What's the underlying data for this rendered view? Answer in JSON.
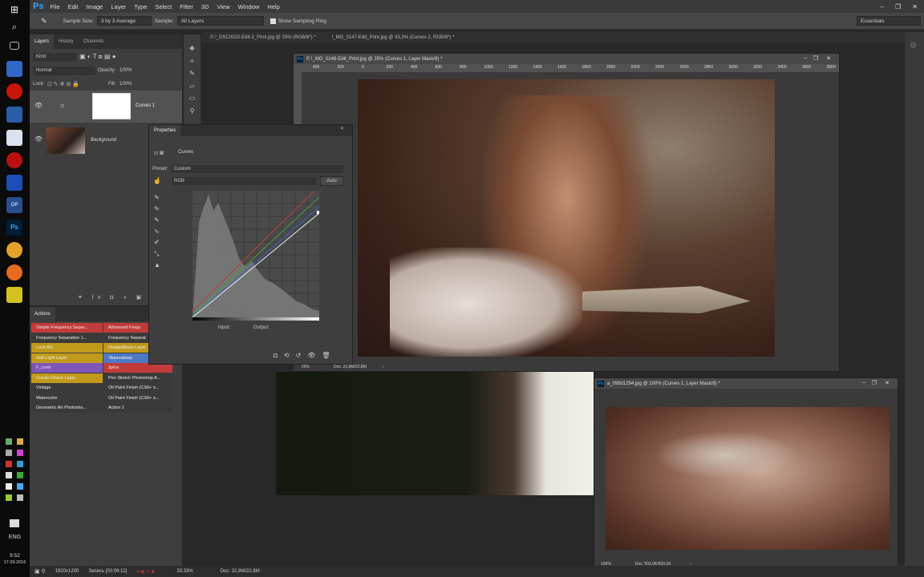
{
  "taskbar": {
    "lang": "ENG",
    "time": "9:52",
    "date": "17.09.2016"
  },
  "app": {
    "logo": "Ps"
  },
  "menu": [
    "File",
    "Edit",
    "Image",
    "Layer",
    "Type",
    "Select",
    "Filter",
    "3D",
    "View",
    "Window",
    "Help"
  ],
  "options": {
    "sample_size_label": "Sample Size:",
    "sample_size": "3 by 3 Average",
    "sample_label": "Sample:",
    "sample": "All Layers",
    "show_ring": "Show Sampling Ring",
    "workspace": "Essentials"
  },
  "layers_panel": {
    "tabs": [
      "Layers",
      "History",
      "Channels"
    ],
    "kind": "Kind",
    "blend": "Normal",
    "opacity_label": "Opacity:",
    "opacity": "100%",
    "lock_label": "Lock:",
    "fill_label": "Fill:",
    "fill": "100%",
    "layers": [
      {
        "name": "Curves 1"
      },
      {
        "name": "Background"
      }
    ]
  },
  "actions_panel": {
    "title": "Actions",
    "col1": [
      {
        "label": "Simple Frequency Separ...",
        "color": "#c23b3b"
      },
      {
        "label": "Frequency Separation 1...",
        "color": "#3a3a3a"
      },
      {
        "label": "Lock BG",
        "color": "#c29a1b"
      },
      {
        "label": "Soft Light Layer",
        "color": "#c29a1b"
      },
      {
        "label": "F_contr",
        "color": "#7d56b8"
      },
      {
        "label": "Create Check-Layer",
        "color": "#c29a1b"
      },
      {
        "label": "Vintage",
        "color": "#3a3a3a"
      },
      {
        "label": "Watercolor",
        "color": "#3a3a3a"
      },
      {
        "label": "Geometric Art Photosho...",
        "color": "#3a3a3a"
      }
    ],
    "col2": [
      {
        "label": "Advanced Frequ",
        "color": "#c23b3b"
      },
      {
        "label": "Frequency Separat",
        "color": "#3a3a3a"
      },
      {
        "label": "Dodge&Burn Layer",
        "color": "#c29a1b"
      },
      {
        "label": "Эквалайзер",
        "color": "#4d78c4"
      },
      {
        "label": "3plos",
        "color": "#c23b3b"
      },
      {
        "label": "Pen Sketch Photoshop A...",
        "color": "#3a3a3a"
      },
      {
        "label": "Oil Paint Finish (CS6+ o...",
        "color": "#3a3a3a"
      },
      {
        "label": "Oil Paint Finish (CS6+ o...",
        "color": "#3a3a3a"
      },
      {
        "label": "Action 1",
        "color": "#3a3a3a"
      }
    ]
  },
  "doc_tabs": [
    "© !_DSC0020-Edit-2_Print.jpg @ 25% (RGB/8*) *",
    "!_MG_0147-Edit_Print.jpg @ 33,3% (Curves 2, RGB/8*) *"
  ],
  "doc1": {
    "title": "© !_MG_0148-Edit_Print.jpg @ 25% (Curves 1, Layer Mask/8) *",
    "ruler": [
      "400",
      "200",
      "0",
      "200",
      "400",
      "600",
      "800",
      "1000",
      "1200",
      "1400",
      "1600",
      "1800",
      "2000",
      "2200",
      "2400",
      "2600",
      "2800",
      "3000",
      "3200",
      "3400",
      "3600",
      "3800"
    ],
    "zoom": "25%",
    "doc": "Doc: 22,8M/22,8M"
  },
  "properties": {
    "title": "Properties",
    "type": "Curves",
    "preset_label": "Preset:",
    "preset": "Custom",
    "channel": "RGB",
    "auto": "Auto",
    "input": "Input:",
    "output": "Output:"
  },
  "doc2": {
    "title": "a_098d1294.jpg @ 100% (Curves 1, Layer Mask/8) *",
    "zoom": "100%",
    "doc": "Doc: 503,0K/503,0K"
  },
  "status": {
    "resolution": "1920x1200",
    "recording": "Запись [00:06:12]",
    "zoom": "33,33%",
    "doc": "Doc: 22,8M/22,8M"
  }
}
